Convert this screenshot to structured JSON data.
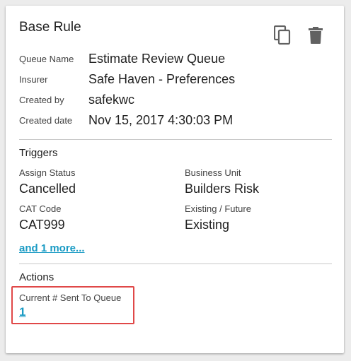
{
  "card": {
    "title": "Base Rule",
    "icons": {
      "copy": "copy-icon",
      "delete": "trash-icon"
    },
    "meta": [
      {
        "label": "Queue Name",
        "value": "Estimate Review Queue"
      },
      {
        "label": "Insurer",
        "value": "Safe Haven - Preferences"
      },
      {
        "label": "Created by",
        "value": "safekwc"
      },
      {
        "label": "Created date",
        "value": "Nov 15, 2017 4:30:03 PM"
      }
    ]
  },
  "triggers": {
    "title": "Triggers",
    "fields": [
      {
        "label": "Assign Status",
        "value": "Cancelled"
      },
      {
        "label": "Business Unit",
        "value": "Builders Risk"
      },
      {
        "label": "CAT Code",
        "value": "CAT999"
      },
      {
        "label": "Existing / Future",
        "value": "Existing"
      }
    ],
    "more_link": "and 1 more..."
  },
  "actions": {
    "title": "Actions",
    "sent_label": "Current # Sent To Queue",
    "sent_value": "1"
  },
  "colors": {
    "link": "#1a9bc4",
    "highlight": "#e04848",
    "icon": "#616161"
  }
}
